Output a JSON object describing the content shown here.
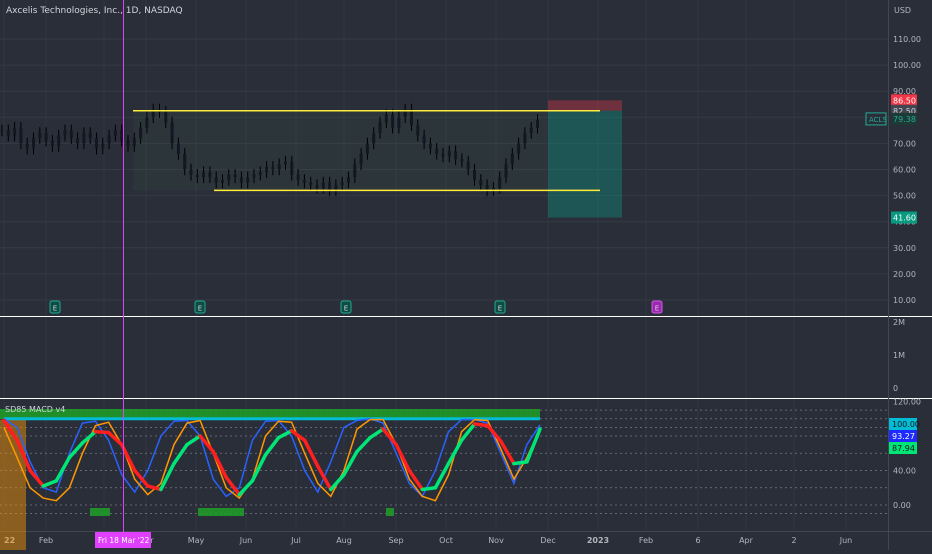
{
  "header": {
    "title": "Axcelis Technologies, Inc., 1D, NASDAQ",
    "currency": "USD"
  },
  "chart_data": [
    {
      "type": "candlestick",
      "title": "Axcelis Technologies, Inc., 1D, NASDAQ",
      "ylabel": "USD",
      "ylim": [
        0,
        120
      ],
      "price_ticks": [
        "110.00",
        "100.00",
        "90.00",
        "80.00",
        "70.00",
        "60.00",
        "50.00",
        "40.00",
        "30.00",
        "20.00",
        "10.00"
      ],
      "price_labels": [
        {
          "text": "86.50",
          "color": "#f23645"
        },
        {
          "text": "82.50",
          "color": "#434651"
        },
        {
          "text": "ACLS",
          "color": "#22ab94"
        },
        {
          "text": "79.38",
          "color": "#22ab94"
        },
        {
          "text": "41.60",
          "color": "#089981"
        }
      ],
      "series": [
        {
          "name": "ACLS",
          "values": [
            75,
            73,
            76,
            70,
            68,
            72,
            74,
            71,
            69,
            73,
            75,
            72,
            70,
            74,
            72,
            68,
            70,
            73,
            75,
            71,
            69,
            72,
            76,
            80,
            83,
            82,
            78,
            70,
            66,
            60,
            58,
            57,
            59,
            57,
            55,
            56,
            58,
            57,
            55,
            57,
            58,
            59,
            61,
            60,
            62,
            63,
            58,
            56,
            55,
            54,
            53,
            55,
            52,
            54,
            55,
            57,
            62,
            66,
            70,
            74,
            78,
            81,
            76,
            80,
            83,
            77,
            73,
            70,
            68,
            66,
            65,
            67,
            64,
            63,
            60,
            56,
            54,
            52,
            53,
            57,
            62,
            66,
            70,
            74,
            76,
            79
          ]
        }
      ],
      "levels": [
        {
          "value": 82.5,
          "color": "#ffeb3b"
        },
        {
          "value": 52,
          "color": "#ffeb3b"
        }
      ],
      "position": {
        "entry": 82.5,
        "stop": 86.5,
        "target": 41.6
      },
      "earnings_markers": [
        "E",
        "E",
        "E",
        "E",
        "E"
      ]
    },
    {
      "type": "bar",
      "title": "Volume",
      "ticks": [
        "2M",
        "1M",
        "0"
      ]
    },
    {
      "type": "line",
      "title": "SD85 MACD v4",
      "ylim": [
        -20,
        120
      ],
      "ticks": [
        "120.00",
        "80.00",
        "40.00",
        "0.00"
      ],
      "value_labels": [
        {
          "text": "100.00",
          "color": "#00bcd4"
        },
        {
          "text": "93.27",
          "color": "#1e2bff"
        },
        {
          "text": "87.94",
          "color": "#00e676"
        }
      ],
      "series": [
        {
          "color": "#00bcd4",
          "values": [
            100,
            100,
            100,
            100,
            100,
            100,
            100,
            100,
            100,
            100,
            100,
            100,
            100,
            100,
            100,
            100,
            100,
            100,
            100,
            100,
            100,
            100,
            100,
            100,
            100,
            100,
            100,
            100,
            100,
            100,
            100,
            100,
            100,
            100,
            100,
            100,
            100,
            100,
            100,
            100,
            100,
            100
          ]
        },
        {
          "color": "#2962ff",
          "values": [
            100,
            90,
            50,
            20,
            15,
            60,
            95,
            97,
            75,
            35,
            15,
            40,
            80,
            97,
            98,
            80,
            30,
            10,
            20,
            75,
            97,
            98,
            80,
            40,
            15,
            50,
            90,
            98,
            100,
            95,
            60,
            25,
            10,
            40,
            85,
            99,
            99,
            95,
            60,
            25,
            70,
            93
          ]
        },
        {
          "color": "#ff9800",
          "values": [
            90,
            55,
            20,
            8,
            5,
            20,
            60,
            92,
            96,
            70,
            30,
            12,
            25,
            70,
            95,
            98,
            60,
            20,
            8,
            30,
            80,
            97,
            96,
            60,
            25,
            10,
            40,
            88,
            99,
            99,
            70,
            30,
            10,
            5,
            35,
            85,
            99,
            98,
            65,
            30,
            55,
            88
          ]
        },
        {
          "color": "#2ecc40",
          "values": [
            98,
            75,
            40,
            22,
            28,
            55,
            72,
            85,
            84,
            70,
            40,
            22,
            18,
            48,
            70,
            80,
            62,
            32,
            12,
            28,
            58,
            78,
            86,
            75,
            45,
            18,
            35,
            62,
            78,
            88,
            70,
            40,
            18,
            20,
            48,
            75,
            94,
            92,
            74,
            48,
            50,
            88
          ]
        }
      ]
    }
  ],
  "x_axis": {
    "labels": [
      "22",
      "Feb",
      "2",
      "Mar",
      "May",
      "Jun",
      "Jul",
      "Aug",
      "Sep",
      "Oct",
      "Nov",
      "Dec",
      "2023",
      "Feb",
      "6",
      "Apr",
      "2",
      "Jun"
    ],
    "crosshair_label": "Fri 18 Mar '22"
  }
}
